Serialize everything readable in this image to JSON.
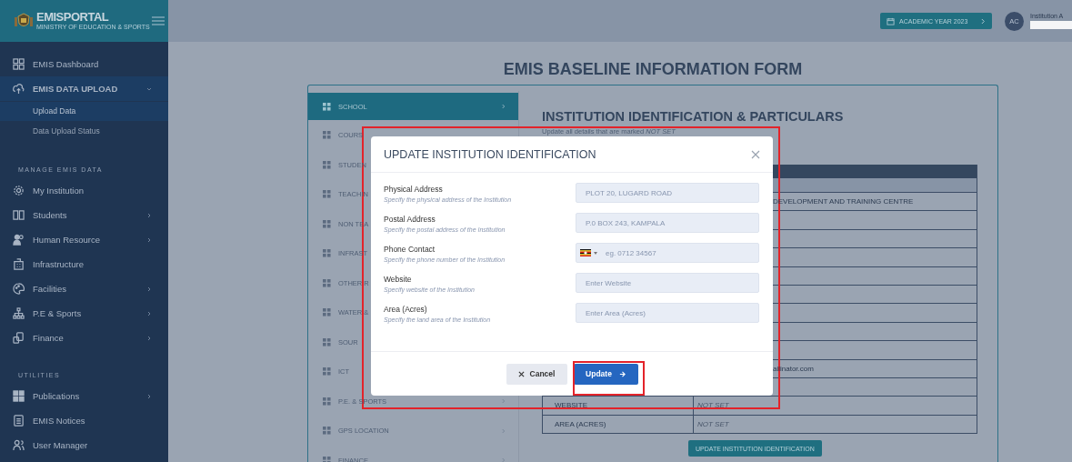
{
  "sidebar": {
    "brand": {
      "title": "EMISPORTAL",
      "subtitle": "MINISTRY OF EDUCATION & SPORTS"
    },
    "sections": [
      {
        "items": [
          {
            "label": "EMIS Dashboard",
            "submenu": false,
            "expanded": false,
            "selected": false
          },
          {
            "label": "EMIS DATA UPLOAD",
            "submenu": true,
            "expanded": true,
            "selected": false,
            "children": [
              {
                "label": "Upload Data",
                "selected": true
              },
              {
                "label": "Data Upload Status",
                "selected": false
              }
            ]
          }
        ]
      },
      {
        "heading": "MANAGE EMIS DATA",
        "items": [
          {
            "label": "My Institution",
            "submenu": false,
            "expanded": false,
            "selected": false
          },
          {
            "label": "Students",
            "submenu": true,
            "expanded": false,
            "selected": false
          },
          {
            "label": "Human Resource",
            "submenu": true,
            "expanded": false,
            "selected": false
          },
          {
            "label": "Infrastructure",
            "submenu": false,
            "expanded": false,
            "selected": false
          },
          {
            "label": "Facilities",
            "submenu": true,
            "expanded": false,
            "selected": false
          },
          {
            "label": "P.E & Sports",
            "submenu": true,
            "expanded": false,
            "selected": false
          },
          {
            "label": "Finance",
            "submenu": true,
            "expanded": false,
            "selected": false
          }
        ]
      },
      {
        "heading": "UTILITIES",
        "items": [
          {
            "label": "Publications",
            "submenu": true,
            "expanded": false,
            "selected": false
          },
          {
            "label": "EMIS Notices",
            "submenu": false,
            "expanded": false,
            "selected": false
          },
          {
            "label": "User Manager",
            "submenu": false,
            "expanded": false,
            "selected": false
          }
        ]
      }
    ]
  },
  "header": {
    "academic_year": "ACADEMIC YEAR 2023",
    "user": {
      "initials": "AC",
      "role": "Institution A"
    }
  },
  "page_title": "EMIS BASELINE INFORMATION FORM",
  "form": {
    "tabs": [
      {
        "label": "SCHOOL",
        "selected": true,
        "chevron": true
      },
      {
        "label": "COURS",
        "selected": false,
        "chevron": false
      },
      {
        "label": "STUDEN",
        "selected": false,
        "chevron": false
      },
      {
        "label": "TEACHIN",
        "selected": false,
        "chevron": false
      },
      {
        "label": "NON TEA",
        "selected": false,
        "chevron": false
      },
      {
        "label": "INFRAST",
        "selected": false,
        "chevron": false
      },
      {
        "label": "OTHER R",
        "selected": false,
        "chevron": false
      },
      {
        "label": "WATER &",
        "selected": false,
        "chevron": false
      },
      {
        "label": "SOUR",
        "selected": false,
        "chevron": false
      },
      {
        "label": "ICT",
        "selected": false,
        "chevron": false
      },
      {
        "label": "P.E. & SPORTS",
        "selected": false,
        "chevron": true
      },
      {
        "label": "GPS LOCATION",
        "selected": false,
        "chevron": true
      },
      {
        "label": "FINANCE",
        "selected": false,
        "chevron": true
      }
    ],
    "panel": {
      "title": "INSTITUTION IDENTIFICATION & PARTICULARS",
      "subtitle": "Update all details that are marked *NOT SET*",
      "rows": [
        {
          "value": "DEVELOPMENT AND TRAINING CENTRE",
          "unset": false
        },
        {},
        {},
        {},
        {},
        {},
        {},
        {},
        {},
        {
          "value": "ailinator.com",
          "unset": false
        },
        {},
        {
          "label": "WEBSITE",
          "value": "NOT SET",
          "unset": true
        },
        {
          "label": "AREA (ACRES)",
          "value": "NOT SET",
          "unset": true
        }
      ],
      "button": "UPDATE INSTITUTION IDENTIFICATION"
    }
  },
  "modal": {
    "title": "UPDATE INSTITUTION IDENTIFICATION",
    "highlighted": true,
    "fields": [
      {
        "kind": "text",
        "label": "Physical Address",
        "hint": "Specify the physical address of the Institution",
        "placeholder": "PLOT 20, LUGARD ROAD"
      },
      {
        "kind": "text",
        "label": "Postal Address",
        "hint": "Specify the postal address of the Institution",
        "placeholder": "P.0 BOX 243, KAMPALA"
      },
      {
        "kind": "phone",
        "label": "Phone Contact",
        "hint": "Specify the phone number of the Institution",
        "placeholder": "eg. 0712 34567"
      },
      {
        "kind": "text",
        "label": "Website",
        "hint": "Specify website of the Institution",
        "placeholder": "Enter Website"
      },
      {
        "kind": "text",
        "label": "Area (Acres)",
        "hint": "Specify the land area of the Institution",
        "placeholder": "Enter Area (Acres)"
      }
    ],
    "cancel": {
      "label": "Cancel"
    },
    "update": {
      "label": "Update",
      "highlighted": true
    }
  }
}
